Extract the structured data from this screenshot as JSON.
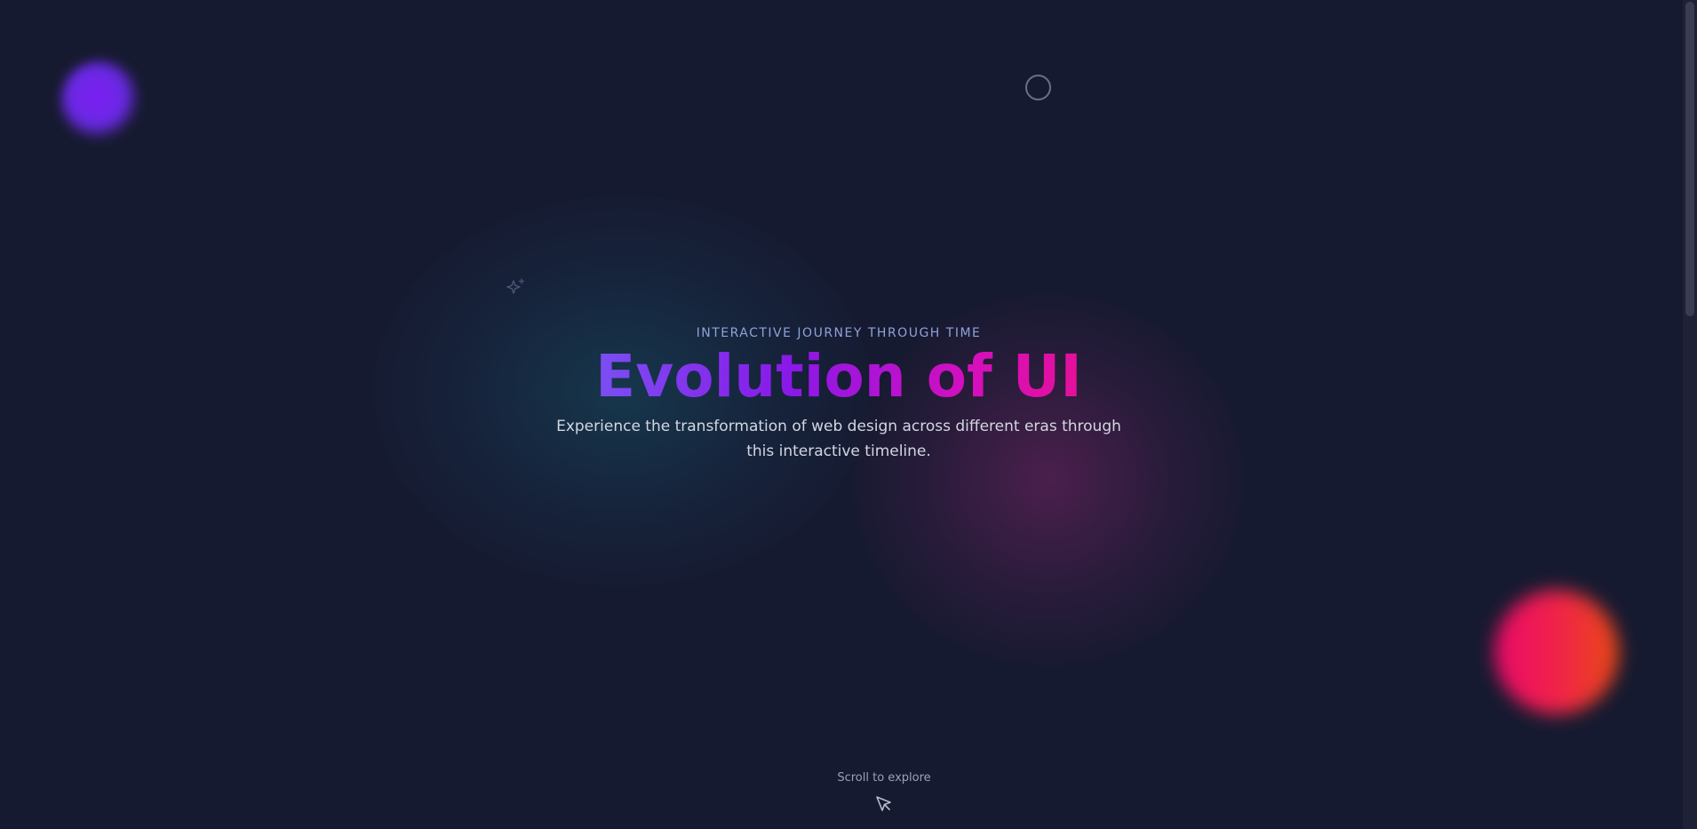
{
  "hero": {
    "eyebrow": "INTERACTIVE JOURNEY THROUGH TIME",
    "title": "Evolution of UI",
    "subtitle": "Experience the transformation of web design across different eras through this interactive timeline."
  },
  "scroll_hint": {
    "label": "Scroll to explore",
    "icon": "cursor-arrow-icon"
  },
  "decorations": {
    "sparkle_icon": "sparkles-icon",
    "ring_icon": "circle-outline-icon"
  },
  "colors": {
    "background": "#161a30",
    "title_gradient_start": "#7b4ff2",
    "title_gradient_end": "#e5109a",
    "eyebrow": "#8fa2d8",
    "subtitle": "#d3d6e2"
  }
}
